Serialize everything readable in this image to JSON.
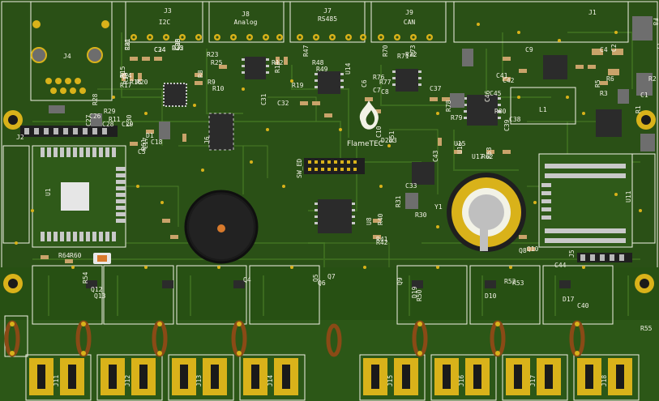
{
  "board": {
    "brand": "FlameTEC",
    "colors": {
      "mask": "#2a5016",
      "mask_dark": "#1f3f10",
      "copper": "#3b6a1e",
      "silk": "#f2f2e6",
      "pad_gold": "#d9b21a",
      "ic_body": "#2b2b2b",
      "buzzer": "#1a1a1a",
      "coil": "#8a4a16"
    }
  },
  "connectors": {
    "j4": "J4",
    "j3": "J3",
    "j3_name": "I2C",
    "j8": "J8",
    "j8_name": "Analog",
    "j7": "J7",
    "j7_name": "RS485",
    "j9": "J9",
    "j9_name": "CAN",
    "j1": "J1",
    "j2": "J2",
    "j6": "J6",
    "j5": "J5",
    "f8": "F8",
    "power": [
      "J11",
      "J12",
      "J13",
      "J14",
      "J15",
      "J16",
      "J17",
      "J18"
    ]
  },
  "ics": {
    "u1": "U1",
    "u11": "U11",
    "u8": "U8",
    "u14": "U14",
    "y1": "Y1",
    "l1": "L1",
    "sw_ed": "SW_ED"
  },
  "refs": [
    "C21",
    "C24",
    "R22",
    "C23",
    "R25",
    "R23",
    "R13",
    "R12",
    "R17",
    "R18",
    "R20",
    "R19",
    "C31",
    "C32",
    "R3",
    "R5",
    "R6",
    "C4",
    "C2",
    "C9",
    "C45",
    "C46",
    "C37",
    "C38",
    "C39",
    "C41",
    "C42",
    "C30",
    "C29",
    "C26",
    "C27",
    "C28",
    "R14",
    "R15",
    "R16",
    "C18",
    "C17",
    "D1",
    "Q8",
    "Q9",
    "Q10",
    "Q4",
    "Q5",
    "Q6",
    "Q7",
    "R40",
    "R41",
    "R42",
    "R31",
    "R30",
    "C33",
    "C43",
    "C44",
    "C40",
    "R50",
    "R55",
    "D10",
    "D19",
    "D17",
    "U15",
    "U16",
    "U17",
    "R62",
    "R63",
    "R64",
    "R60",
    "R61",
    "C5",
    "C1",
    "R1",
    "R2",
    "C11",
    "C10",
    "D2",
    "D3",
    "R51",
    "R52",
    "R53",
    "R54",
    "Q12",
    "Q13",
    "R8",
    "R9",
    "R10",
    "R28",
    "R29",
    "R11",
    "C6",
    "C7",
    "C8",
    "R47",
    "R48",
    "R49",
    "R70",
    "R71",
    "R72",
    "R73",
    "R76",
    "R77",
    "R78",
    "R79",
    "R80",
    "R81",
    "C34",
    "C35",
    "C36"
  ]
}
